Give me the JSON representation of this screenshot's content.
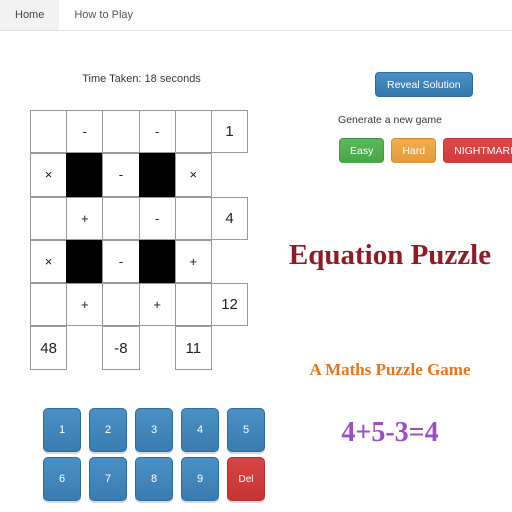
{
  "nav": {
    "items": [
      {
        "label": "Home",
        "active": true
      },
      {
        "label": "How to Play",
        "active": false
      }
    ]
  },
  "status": {
    "timer": "Time Taken: 18 seconds"
  },
  "puzzle": {
    "rows": 6,
    "cols": 6,
    "cells": [
      [
        {
          "text": "",
          "type": "input"
        },
        {
          "text": "-",
          "type": "op"
        },
        {
          "text": "",
          "type": "input"
        },
        {
          "text": "-",
          "type": "op"
        },
        {
          "text": "",
          "type": "input"
        },
        {
          "text": "1",
          "type": "result"
        }
      ],
      [
        {
          "text": "×",
          "type": "op"
        },
        {
          "text": "",
          "type": "black"
        },
        {
          "text": "-",
          "type": "op"
        },
        {
          "text": "",
          "type": "black"
        },
        {
          "text": "×",
          "type": "op"
        },
        {
          "text": "",
          "type": "void"
        }
      ],
      [
        {
          "text": "",
          "type": "input"
        },
        {
          "text": "+",
          "type": "op"
        },
        {
          "text": "",
          "type": "input"
        },
        {
          "text": "-",
          "type": "op"
        },
        {
          "text": "",
          "type": "input"
        },
        {
          "text": "4",
          "type": "result"
        }
      ],
      [
        {
          "text": "×",
          "type": "op"
        },
        {
          "text": "",
          "type": "black"
        },
        {
          "text": "-",
          "type": "op"
        },
        {
          "text": "",
          "type": "black"
        },
        {
          "text": "+",
          "type": "op"
        },
        {
          "text": "",
          "type": "void"
        }
      ],
      [
        {
          "text": "",
          "type": "input"
        },
        {
          "text": "+",
          "type": "op"
        },
        {
          "text": "",
          "type": "input"
        },
        {
          "text": "+",
          "type": "op"
        },
        {
          "text": "",
          "type": "input"
        },
        {
          "text": "12",
          "type": "result"
        }
      ],
      [
        {
          "text": "48",
          "type": "result"
        },
        {
          "text": "",
          "type": "void"
        },
        {
          "text": "-8",
          "type": "result"
        },
        {
          "text": "",
          "type": "void"
        },
        {
          "text": "11",
          "type": "result"
        },
        {
          "text": "",
          "type": "void"
        }
      ]
    ]
  },
  "keypad": {
    "rows": [
      [
        {
          "label": "1",
          "kind": "num"
        },
        {
          "label": "2",
          "kind": "num"
        },
        {
          "label": "3",
          "kind": "num"
        },
        {
          "label": "4",
          "kind": "num"
        },
        {
          "label": "5",
          "kind": "num"
        }
      ],
      [
        {
          "label": "6",
          "kind": "num"
        },
        {
          "label": "7",
          "kind": "num"
        },
        {
          "label": "8",
          "kind": "num"
        },
        {
          "label": "9",
          "kind": "num"
        },
        {
          "label": "Del",
          "kind": "del"
        }
      ]
    ]
  },
  "panel": {
    "reveal_label": "Reveal Solution",
    "generate_label": "Generate a new game",
    "difficulties": [
      {
        "label": "Easy",
        "style": "easy"
      },
      {
        "label": "Hard",
        "style": "hard"
      },
      {
        "label": "NIGHTMARE",
        "style": "night"
      }
    ],
    "brand_title": "Equation Puzzle",
    "brand_subtitle": "A Maths Puzzle Game",
    "brand_equation": "4+5-3=4"
  },
  "colors": {
    "reveal_blue": "#3479ad",
    "easy_green": "#5cb85c",
    "hard_orange": "#f0ad4e",
    "nightmare_red": "#e04848",
    "key_blue": "#4a90c4",
    "del_red": "#d64545",
    "title_red": "#8c1c26",
    "subtitle_orange": "#e8751a",
    "equation_purple": "#9b4fc4"
  }
}
